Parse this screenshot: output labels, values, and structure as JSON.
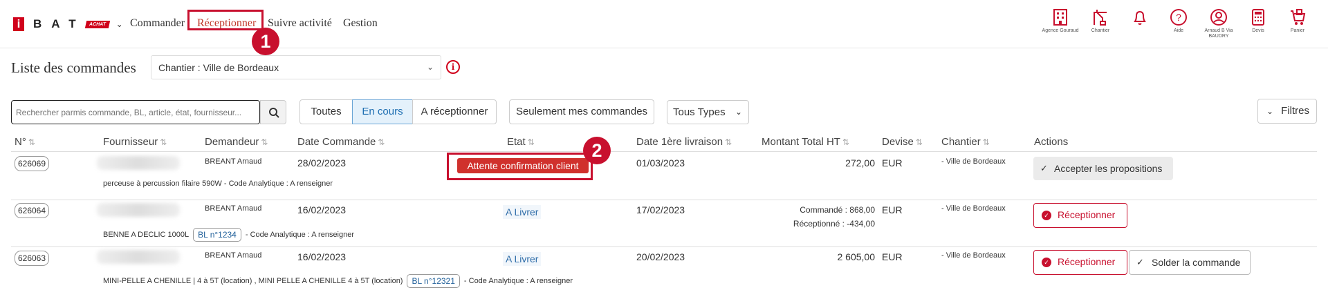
{
  "header": {
    "logo_i": "i",
    "logo_letters": "BAT",
    "logo_tag": "ACHAT",
    "nav": [
      "Commander",
      "Réceptionner",
      "Suivre activité",
      "Gestion"
    ],
    "active_nav_index": 1,
    "icons": [
      {
        "name": "agence-icon",
        "label": "Agence Gouraud"
      },
      {
        "name": "chantier-icon",
        "label": "Chantier"
      },
      {
        "name": "bell-icon",
        "label": ""
      },
      {
        "name": "help-icon",
        "label": "Aide"
      },
      {
        "name": "user-icon",
        "label": "Arnaud B Via BAUDRY"
      },
      {
        "name": "calculator-icon",
        "label": "Devis"
      },
      {
        "name": "cart-icon",
        "label": "Panier"
      }
    ]
  },
  "steps": {
    "one": "1",
    "two": "2"
  },
  "title": "Liste des commandes",
  "chantier_select": "Chantier : Ville de Bordeaux",
  "info_glyph": "i",
  "search": {
    "placeholder": "Rechercher parmis commande, BL, article, état, fournisseur..."
  },
  "segments": [
    "Toutes",
    "En cours",
    "A réceptionner"
  ],
  "active_segment": 1,
  "mine_button": "Seulement mes commandes",
  "type_select": "Tous Types",
  "filters_button": "Filtres",
  "columns": [
    "N°",
    "Fournisseur",
    "Demandeur",
    "Date Commande",
    "Etat",
    "Date 1ère livraison",
    "Montant Total HT",
    "Devise",
    "Chantier",
    "Actions"
  ],
  "rows": [
    {
      "num": "626069",
      "demandeur": "BREANT Arnaud",
      "date_commande": "28/02/2023",
      "etat": "Attente confirmation client",
      "date_livraison": "01/03/2023",
      "montant": "272,00",
      "devise": "EUR",
      "chantier": "- Ville de Bordeaux",
      "desc": "perceuse à percussion filaire 590W - Code Analytique : A renseigner",
      "action_primary": "Accepter les propositions"
    },
    {
      "num": "626064",
      "demandeur": "BREANT Arnaud",
      "date_commande": "16/02/2023",
      "etat": "A Livrer",
      "date_livraison": "17/02/2023",
      "montant_commande": "Commandé : 868,00",
      "montant_receptionne": "Réceptionné : -434,00",
      "devise": "EUR",
      "chantier": "- Ville de Bordeaux",
      "desc_left": "BENNE A DECLIC 1000L",
      "bl": "BL n°1234",
      "desc_right": "- Code Analytique : A renseigner",
      "action_primary": "Réceptionner"
    },
    {
      "num": "626063",
      "demandeur": "BREANT Arnaud",
      "date_commande": "16/02/2023",
      "etat": "A Livrer",
      "date_livraison": "20/02/2023",
      "montant": "2 605,00",
      "devise": "EUR",
      "chantier": "- Ville de Bordeaux",
      "desc_left": "MINI-PELLE A CHENILLE | 4 à 5T (location) , MINI PELLE A CHENILLE 4 à 5T (location)",
      "bl": "BL n°12321",
      "desc_right": "- Code Analytique : A renseigner",
      "action_primary": "Réceptionner",
      "action_secondary": "Solder la commande"
    }
  ],
  "colors": {
    "brand_red": "#d0021b",
    "highlight": "#c8102e",
    "link_blue": "#2e6ca8"
  }
}
